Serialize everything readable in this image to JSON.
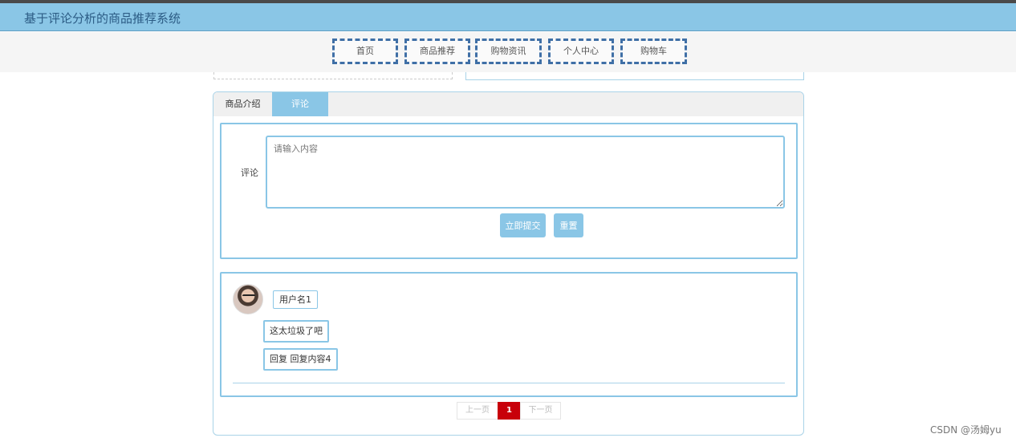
{
  "header": {
    "title": "基于评论分析的商品推荐系统"
  },
  "nav": [
    {
      "label": "首页"
    },
    {
      "label": "商品推荐"
    },
    {
      "label": "购物资讯"
    },
    {
      "label": "个人中心"
    },
    {
      "label": "购物车"
    }
  ],
  "tabs": {
    "intro": "商品介绍",
    "comments": "评论",
    "active": "评论"
  },
  "form": {
    "label": "评论",
    "placeholder": "请输入内容",
    "submit": "立即提交",
    "reset": "重置"
  },
  "comments": [
    {
      "user": "用户名1",
      "content": "这太垃圾了吧",
      "reply": "回复 回复内容4"
    }
  ],
  "pagination": {
    "prev": "上一页",
    "current": "1",
    "next": "下一页"
  },
  "watermark": "CSDN @汤姆yu",
  "colors": {
    "accent": "#8ac6e6",
    "nav_border": "#3f6fa6",
    "page_active": "#c8000a"
  }
}
